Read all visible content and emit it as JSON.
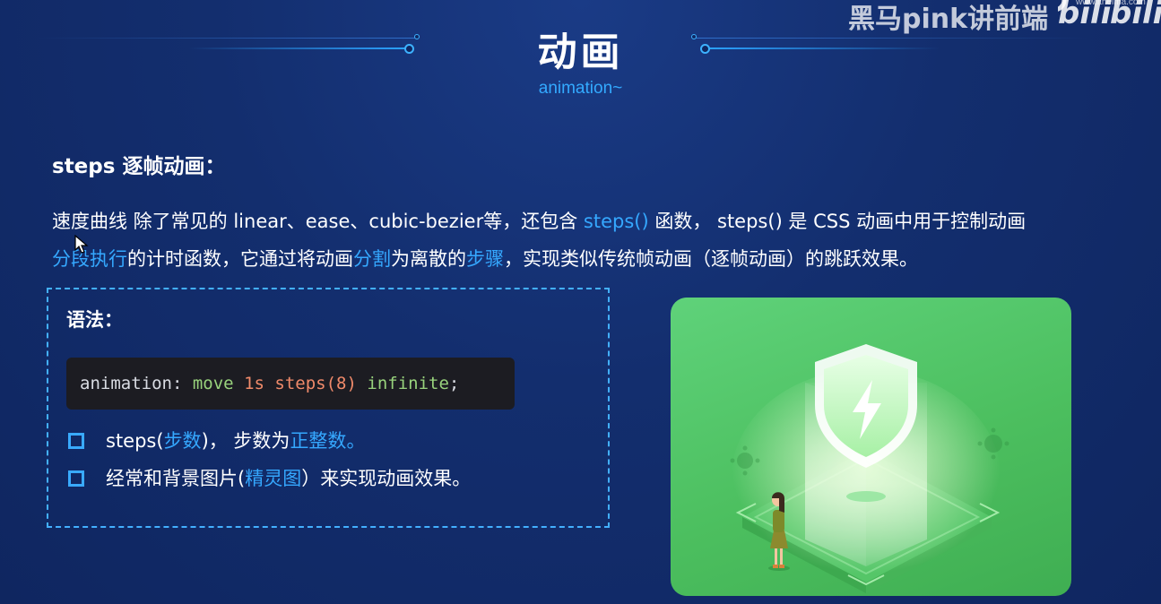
{
  "slide": {
    "title": "动画",
    "subtitle": "animation~"
  },
  "watermark": {
    "text": "黑马pink讲前端",
    "logo": "bilibili",
    "site": "www.itheima.com"
  },
  "section": {
    "heading": "steps 逐帧动画："
  },
  "paragraph": {
    "p1": "速度曲线 除了常见的 linear、ease、cubic-bezier等，还包含 ",
    "h1": "steps()",
    "p2": " 函数， steps() 是 CSS 动画中用于控制动画",
    "h2": "分段执行",
    "p3": "的计时函数，它通过将动画",
    "h3": "分割",
    "p4": "为离散的",
    "h4": "步骤",
    "p5": "，实现类似传统帧动画（逐帧动画）的跳跃效果。"
  },
  "syntax": {
    "title": "语法：",
    "code": {
      "prop": "animation",
      "colon": ": ",
      "name": "move",
      "sp1": " ",
      "duration": "1s",
      "sp2": " ",
      "fn": "steps(8)",
      "sp3": " ",
      "iteration": "infinite",
      "semi": ";"
    },
    "bullets": [
      {
        "pre": "steps(",
        "hl": "步数",
        "mid": ")，  步数为",
        "hl2": "正整数",
        "post": "。"
      },
      {
        "pre": "经常和背景图片(",
        "hl": "精灵图",
        "post": "）来实现动画效果。"
      }
    ]
  },
  "colors": {
    "background": "#132e6e",
    "accent": "#35a8ff",
    "code_bg": "#1c1c22",
    "illustration_green": "#4cbf5f"
  },
  "icons": {
    "bullet": "square-bullet-icon",
    "illustration": "security-shield-illustration",
    "cursor": "mouse-cursor-icon"
  }
}
